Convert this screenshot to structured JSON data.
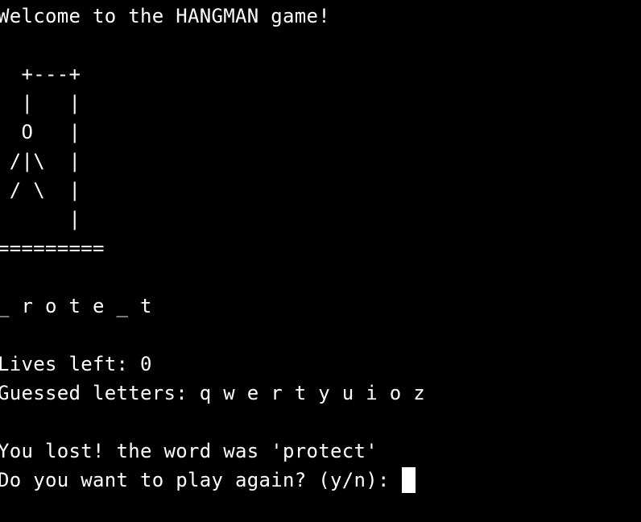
{
  "colors": {
    "background": "#000000",
    "foreground": "#ffffff",
    "cursor": "#ffffff"
  },
  "terminal": {
    "title_line": "Welcome to the HANGMAN game!",
    "gallows": [
      "  +---+",
      "  |   |",
      "  O   |",
      " /|\\  |",
      " / \\  |",
      "      |",
      "========="
    ],
    "word_line": "_ r o t e _ t",
    "lives_line": "Lives left: 0",
    "guessed_line": "Guessed letters: q w e r t y u i o z",
    "result_line": "You lost! the word was 'protect'",
    "prompt_line": "Do you want to play again? (y/n): "
  }
}
